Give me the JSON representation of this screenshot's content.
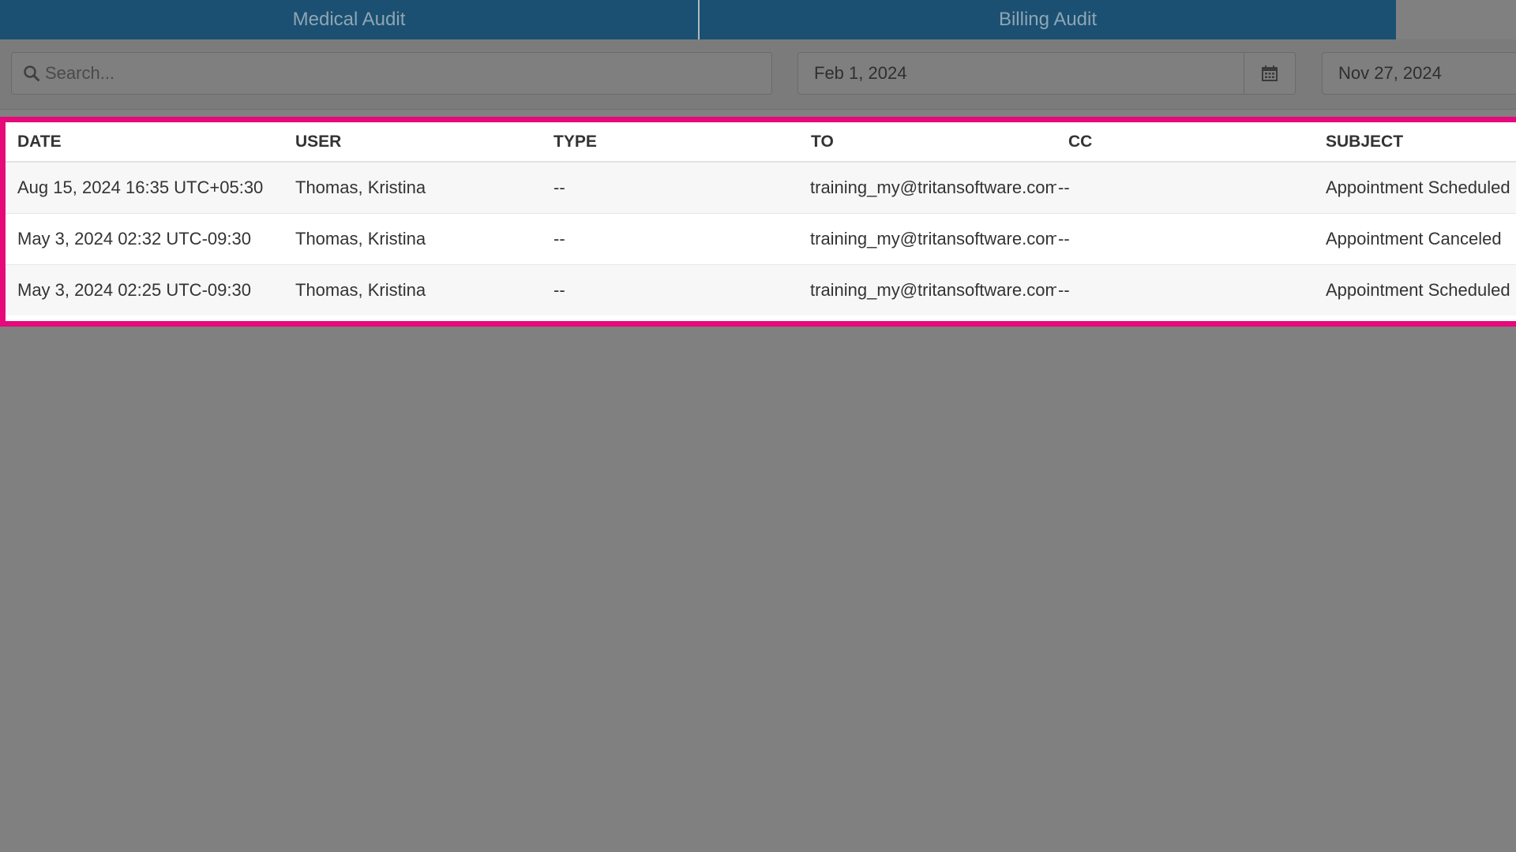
{
  "tabs": [
    {
      "label": "Medical Audit"
    },
    {
      "label": "Billing Audit"
    }
  ],
  "search": {
    "placeholder": "Search...",
    "icon": "search-icon"
  },
  "date_range": {
    "from": "Feb 1, 2024",
    "to": "Nov 27, 2024",
    "icon": "calendar-icon"
  },
  "table": {
    "columns": [
      "DATE",
      "USER",
      "TYPE",
      "TO",
      "CC",
      "SUBJECT"
    ],
    "rows": [
      {
        "date": "Aug 15, 2024 16:35 UTC+05:30",
        "user": "Thomas, Kristina",
        "type": "--",
        "to": "training_my@tritansoftware.com",
        "cc": "--",
        "subject": "Appointment Scheduled"
      },
      {
        "date": "May 3, 2024 02:32 UTC-09:30",
        "user": "Thomas, Kristina",
        "type": "--",
        "to": "training_my@tritansoftware.com",
        "cc": "--",
        "subject": "Appointment Canceled"
      },
      {
        "date": "May 3, 2024 02:25 UTC-09:30",
        "user": "Thomas, Kristina",
        "type": "--",
        "to": "training_my@tritansoftware.com",
        "cc": "--",
        "subject": "Appointment Scheduled"
      }
    ]
  },
  "colors": {
    "tab_bg": "#1b5072",
    "highlight_border": "#e5097a",
    "overlay": "#808080"
  }
}
